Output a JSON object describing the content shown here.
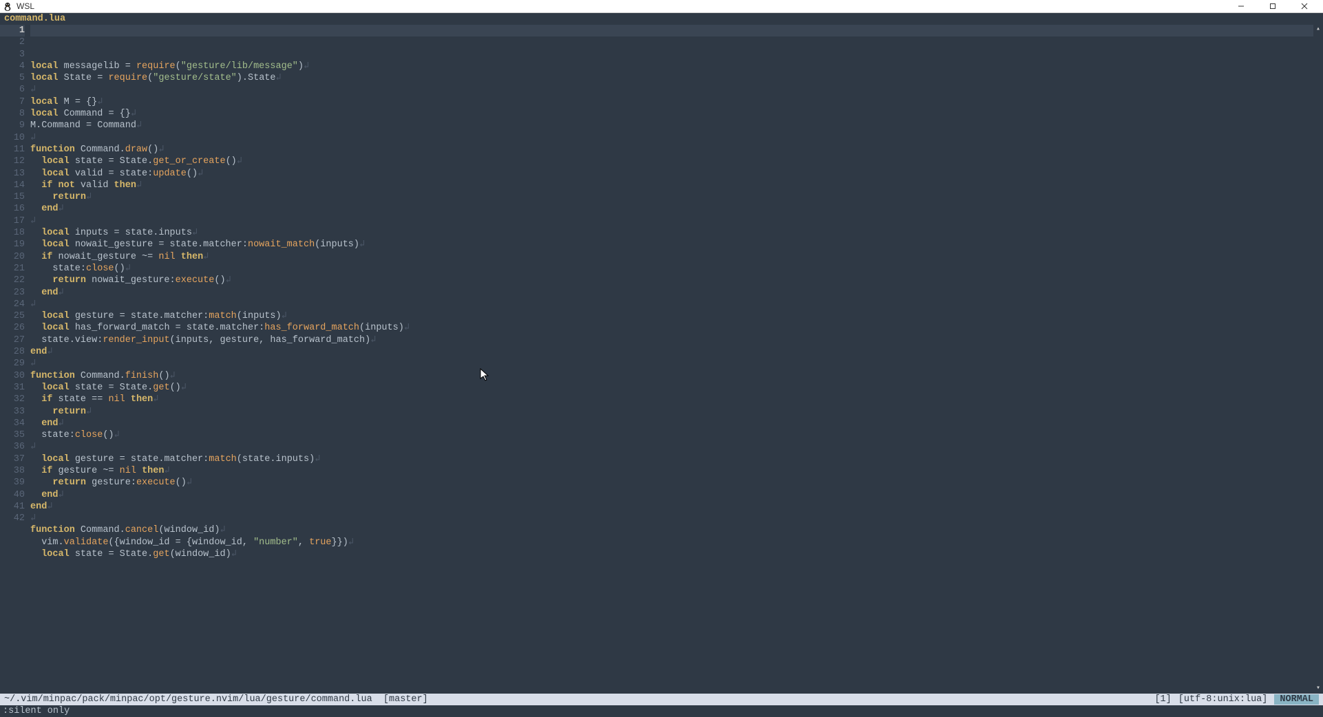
{
  "window": {
    "title": "WSL",
    "buttons": {
      "min": "min",
      "max": "max",
      "close": "close"
    }
  },
  "tab": {
    "filename": "command.lua"
  },
  "gutter": {
    "cursor_line": 1,
    "lines": [
      "1",
      "2",
      "3",
      "4",
      "5",
      "6",
      "7",
      "8",
      "9",
      "10",
      "11",
      "12",
      "13",
      "14",
      "15",
      "16",
      "17",
      "18",
      "19",
      "20",
      "21",
      "22",
      "23",
      "24",
      "25",
      "26",
      "27",
      "28",
      "29",
      "30",
      "31",
      "32",
      "33",
      "34",
      "35",
      "36",
      "37",
      "38",
      "39",
      "40",
      "41",
      "42"
    ]
  },
  "status": {
    "path": "~/.vim/minpac/pack/minpac/opt/gesture.nvim/lua/gesture/command.lua",
    "branch": "[master]",
    "position": "[1]",
    "encoding": "[utf-8:unix:lua]",
    "mode": "NORMAL"
  },
  "cmdline": ":silent only",
  "code_lines": [
    [
      [
        "kw",
        "local"
      ],
      [
        "id",
        " messagelib "
      ],
      [
        "op",
        "= "
      ],
      [
        "fn",
        "require"
      ],
      [
        "op",
        "("
      ],
      [
        "str",
        "\"gesture/lib/message\""
      ],
      [
        "op",
        ")"
      ],
      [
        "eol",
        "↲"
      ]
    ],
    [
      [
        "kw",
        "local"
      ],
      [
        "id",
        " State "
      ],
      [
        "op",
        "= "
      ],
      [
        "fn",
        "require"
      ],
      [
        "op",
        "("
      ],
      [
        "str",
        "\"gesture/state\""
      ],
      [
        "op",
        ")."
      ],
      [
        "id",
        "State"
      ],
      [
        "eol",
        "↲"
      ]
    ],
    [
      [
        "eol",
        "↲"
      ]
    ],
    [
      [
        "kw",
        "local"
      ],
      [
        "id",
        " M "
      ],
      [
        "op",
        "= {}"
      ],
      [
        "eol",
        "↲"
      ]
    ],
    [
      [
        "kw",
        "local"
      ],
      [
        "id",
        " Command "
      ],
      [
        "op",
        "= {}"
      ],
      [
        "eol",
        "↲"
      ]
    ],
    [
      [
        "id",
        "M.Command "
      ],
      [
        "op",
        "= "
      ],
      [
        "id",
        "Command"
      ],
      [
        "eol",
        "↲"
      ]
    ],
    [
      [
        "eol",
        "↲"
      ]
    ],
    [
      [
        "kw",
        "function"
      ],
      [
        "id",
        " Command."
      ],
      [
        "fn",
        "draw"
      ],
      [
        "op",
        "()"
      ],
      [
        "eol",
        "↲"
      ]
    ],
    [
      [
        "id",
        "  "
      ],
      [
        "kw",
        "local"
      ],
      [
        "id",
        " state "
      ],
      [
        "op",
        "= "
      ],
      [
        "id",
        "State."
      ],
      [
        "fn",
        "get_or_create"
      ],
      [
        "op",
        "()"
      ],
      [
        "eol",
        "↲"
      ]
    ],
    [
      [
        "id",
        "  "
      ],
      [
        "kw",
        "local"
      ],
      [
        "id",
        " valid "
      ],
      [
        "op",
        "= "
      ],
      [
        "id",
        "state:"
      ],
      [
        "fn",
        "update"
      ],
      [
        "op",
        "()"
      ],
      [
        "eol",
        "↲"
      ]
    ],
    [
      [
        "id",
        "  "
      ],
      [
        "kw",
        "if"
      ],
      [
        "id",
        " "
      ],
      [
        "kw",
        "not"
      ],
      [
        "id",
        " valid "
      ],
      [
        "kw",
        "then"
      ],
      [
        "eol",
        "↲"
      ]
    ],
    [
      [
        "id",
        "    "
      ],
      [
        "kw",
        "return"
      ],
      [
        "eol",
        "↲"
      ]
    ],
    [
      [
        "id",
        "  "
      ],
      [
        "kw",
        "end"
      ],
      [
        "eol",
        "↲"
      ]
    ],
    [
      [
        "eol",
        "↲"
      ]
    ],
    [
      [
        "id",
        "  "
      ],
      [
        "kw",
        "local"
      ],
      [
        "id",
        " inputs "
      ],
      [
        "op",
        "= "
      ],
      [
        "id",
        "state.inputs"
      ],
      [
        "eol",
        "↲"
      ]
    ],
    [
      [
        "id",
        "  "
      ],
      [
        "kw",
        "local"
      ],
      [
        "id",
        " nowait_gesture "
      ],
      [
        "op",
        "= "
      ],
      [
        "id",
        "state.matcher:"
      ],
      [
        "fn",
        "nowait_match"
      ],
      [
        "op",
        "("
      ],
      [
        "id",
        "inputs"
      ],
      [
        "op",
        ")"
      ],
      [
        "eol",
        "↲"
      ]
    ],
    [
      [
        "id",
        "  "
      ],
      [
        "kw",
        "if"
      ],
      [
        "id",
        " nowait_gesture "
      ],
      [
        "op",
        "~= "
      ],
      [
        "const",
        "nil"
      ],
      [
        "id",
        " "
      ],
      [
        "kw",
        "then"
      ],
      [
        "eol",
        "↲"
      ]
    ],
    [
      [
        "id",
        "    state:"
      ],
      [
        "fn",
        "close"
      ],
      [
        "op",
        "()"
      ],
      [
        "eol",
        "↲"
      ]
    ],
    [
      [
        "id",
        "    "
      ],
      [
        "kw",
        "return"
      ],
      [
        "id",
        " nowait_gesture:"
      ],
      [
        "fn",
        "execute"
      ],
      [
        "op",
        "()"
      ],
      [
        "eol",
        "↲"
      ]
    ],
    [
      [
        "id",
        "  "
      ],
      [
        "kw",
        "end"
      ],
      [
        "eol",
        "↲"
      ]
    ],
    [
      [
        "eol",
        "↲"
      ]
    ],
    [
      [
        "id",
        "  "
      ],
      [
        "kw",
        "local"
      ],
      [
        "id",
        " gesture "
      ],
      [
        "op",
        "= "
      ],
      [
        "id",
        "state.matcher:"
      ],
      [
        "fn",
        "match"
      ],
      [
        "op",
        "("
      ],
      [
        "id",
        "inputs"
      ],
      [
        "op",
        ")"
      ],
      [
        "eol",
        "↲"
      ]
    ],
    [
      [
        "id",
        "  "
      ],
      [
        "kw",
        "local"
      ],
      [
        "id",
        " has_forward_match "
      ],
      [
        "op",
        "= "
      ],
      [
        "id",
        "state.matcher:"
      ],
      [
        "fn",
        "has_forward_match"
      ],
      [
        "op",
        "("
      ],
      [
        "id",
        "inputs"
      ],
      [
        "op",
        ")"
      ],
      [
        "eol",
        "↲"
      ]
    ],
    [
      [
        "id",
        "  state.view:"
      ],
      [
        "fn",
        "render_input"
      ],
      [
        "op",
        "("
      ],
      [
        "id",
        "inputs, gesture, has_forward_match"
      ],
      [
        "op",
        ")"
      ],
      [
        "eol",
        "↲"
      ]
    ],
    [
      [
        "kw",
        "end"
      ],
      [
        "eol",
        "↲"
      ]
    ],
    [
      [
        "eol",
        "↲"
      ]
    ],
    [
      [
        "kw",
        "function"
      ],
      [
        "id",
        " Command."
      ],
      [
        "fn",
        "finish"
      ],
      [
        "op",
        "()"
      ],
      [
        "eol",
        "↲"
      ]
    ],
    [
      [
        "id",
        "  "
      ],
      [
        "kw",
        "local"
      ],
      [
        "id",
        " state "
      ],
      [
        "op",
        "= "
      ],
      [
        "id",
        "State."
      ],
      [
        "fn",
        "get"
      ],
      [
        "op",
        "()"
      ],
      [
        "eol",
        "↲"
      ]
    ],
    [
      [
        "id",
        "  "
      ],
      [
        "kw",
        "if"
      ],
      [
        "id",
        " state "
      ],
      [
        "op",
        "== "
      ],
      [
        "const",
        "nil"
      ],
      [
        "id",
        " "
      ],
      [
        "kw",
        "then"
      ],
      [
        "eol",
        "↲"
      ]
    ],
    [
      [
        "id",
        "    "
      ],
      [
        "kw",
        "return"
      ],
      [
        "eol",
        "↲"
      ]
    ],
    [
      [
        "id",
        "  "
      ],
      [
        "kw",
        "end"
      ],
      [
        "eol",
        "↲"
      ]
    ],
    [
      [
        "id",
        "  state:"
      ],
      [
        "fn",
        "close"
      ],
      [
        "op",
        "()"
      ],
      [
        "eol",
        "↲"
      ]
    ],
    [
      [
        "eol",
        "↲"
      ]
    ],
    [
      [
        "id",
        "  "
      ],
      [
        "kw",
        "local"
      ],
      [
        "id",
        " gesture "
      ],
      [
        "op",
        "= "
      ],
      [
        "id",
        "state.matcher:"
      ],
      [
        "fn",
        "match"
      ],
      [
        "op",
        "("
      ],
      [
        "id",
        "state.inputs"
      ],
      [
        "op",
        ")"
      ],
      [
        "eol",
        "↲"
      ]
    ],
    [
      [
        "id",
        "  "
      ],
      [
        "kw",
        "if"
      ],
      [
        "id",
        " gesture "
      ],
      [
        "op",
        "~= "
      ],
      [
        "const",
        "nil"
      ],
      [
        "id",
        " "
      ],
      [
        "kw",
        "then"
      ],
      [
        "eol",
        "↲"
      ]
    ],
    [
      [
        "id",
        "    "
      ],
      [
        "kw",
        "return"
      ],
      [
        "id",
        " gesture:"
      ],
      [
        "fn",
        "execute"
      ],
      [
        "op",
        "()"
      ],
      [
        "eol",
        "↲"
      ]
    ],
    [
      [
        "id",
        "  "
      ],
      [
        "kw",
        "end"
      ],
      [
        "eol",
        "↲"
      ]
    ],
    [
      [
        "kw",
        "end"
      ],
      [
        "eol",
        "↲"
      ]
    ],
    [
      [
        "eol",
        "↲"
      ]
    ],
    [
      [
        "kw",
        "function"
      ],
      [
        "id",
        " Command."
      ],
      [
        "fn",
        "cancel"
      ],
      [
        "op",
        "("
      ],
      [
        "id",
        "window_id"
      ],
      [
        "op",
        ")"
      ],
      [
        "eol",
        "↲"
      ]
    ],
    [
      [
        "id",
        "  vim."
      ],
      [
        "fn",
        "validate"
      ],
      [
        "op",
        "({"
      ],
      [
        "id",
        "window_id "
      ],
      [
        "op",
        "= {"
      ],
      [
        "id",
        "window_id, "
      ],
      [
        "str",
        "\"number\""
      ],
      [
        "op",
        ", "
      ],
      [
        "const",
        "true"
      ],
      [
        "op",
        "}})"
      ],
      [
        "eol",
        "↲"
      ]
    ],
    [
      [
        "id",
        "  "
      ],
      [
        "kw",
        "local"
      ],
      [
        "id",
        " state "
      ],
      [
        "op",
        "= "
      ],
      [
        "id",
        "State."
      ],
      [
        "fn",
        "get"
      ],
      [
        "op",
        "("
      ],
      [
        "id",
        "window_id"
      ],
      [
        "op",
        ")"
      ],
      [
        "eol",
        "↲"
      ]
    ]
  ]
}
